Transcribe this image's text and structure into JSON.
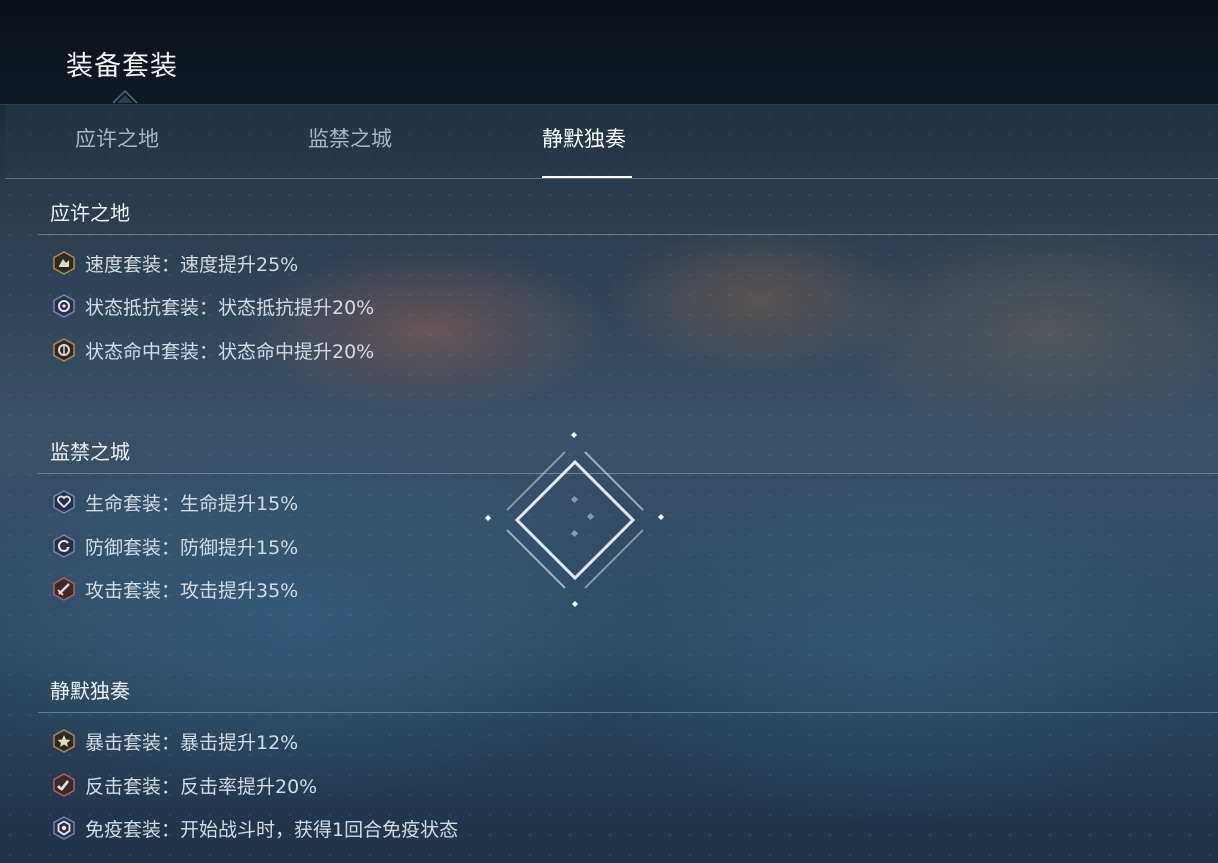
{
  "header": {
    "title": "装备套装"
  },
  "tabs": [
    {
      "label": "应许之地",
      "active": false
    },
    {
      "label": "监禁之城",
      "active": false
    },
    {
      "label": "静默独奏",
      "active": true
    }
  ],
  "sections": [
    {
      "title": "应许之地",
      "items": [
        {
          "icon": "speed-set-icon",
          "text": "速度套装：速度提升25%",
          "color": "#b48650"
        },
        {
          "icon": "resist-set-icon",
          "text": "状态抵抗套装：状态抵抗提升20%",
          "color": "#6f84b8"
        },
        {
          "icon": "accuracy-set-icon",
          "text": "状态命中套装：状态命中提升20%",
          "color": "#b48650"
        }
      ]
    },
    {
      "title": "监禁之城",
      "items": [
        {
          "icon": "health-set-icon",
          "text": "生命套装：生命提升15%",
          "color": "#6f84b8"
        },
        {
          "icon": "defense-set-icon",
          "text": "防御套装：防御提升15%",
          "color": "#6f84b8"
        },
        {
          "icon": "attack-set-icon",
          "text": "攻击套装：攻击提升35%",
          "color": "#b0605a"
        }
      ]
    },
    {
      "title": "静默独奏",
      "items": [
        {
          "icon": "crit-set-icon",
          "text": "暴击套装：暴击提升12%",
          "color": "#b48650"
        },
        {
          "icon": "counter-set-icon",
          "text": "反击套装：反击率提升20%",
          "color": "#b0605a"
        },
        {
          "icon": "immunity-set-icon",
          "text": "免疫套装：开始战斗时，获得1回合免疫状态",
          "color": "#6f84b8"
        }
      ]
    }
  ],
  "colors": {
    "accent": "#ffffff",
    "gold": "#b48650",
    "blue": "#6f84b8",
    "red": "#b0605a"
  }
}
